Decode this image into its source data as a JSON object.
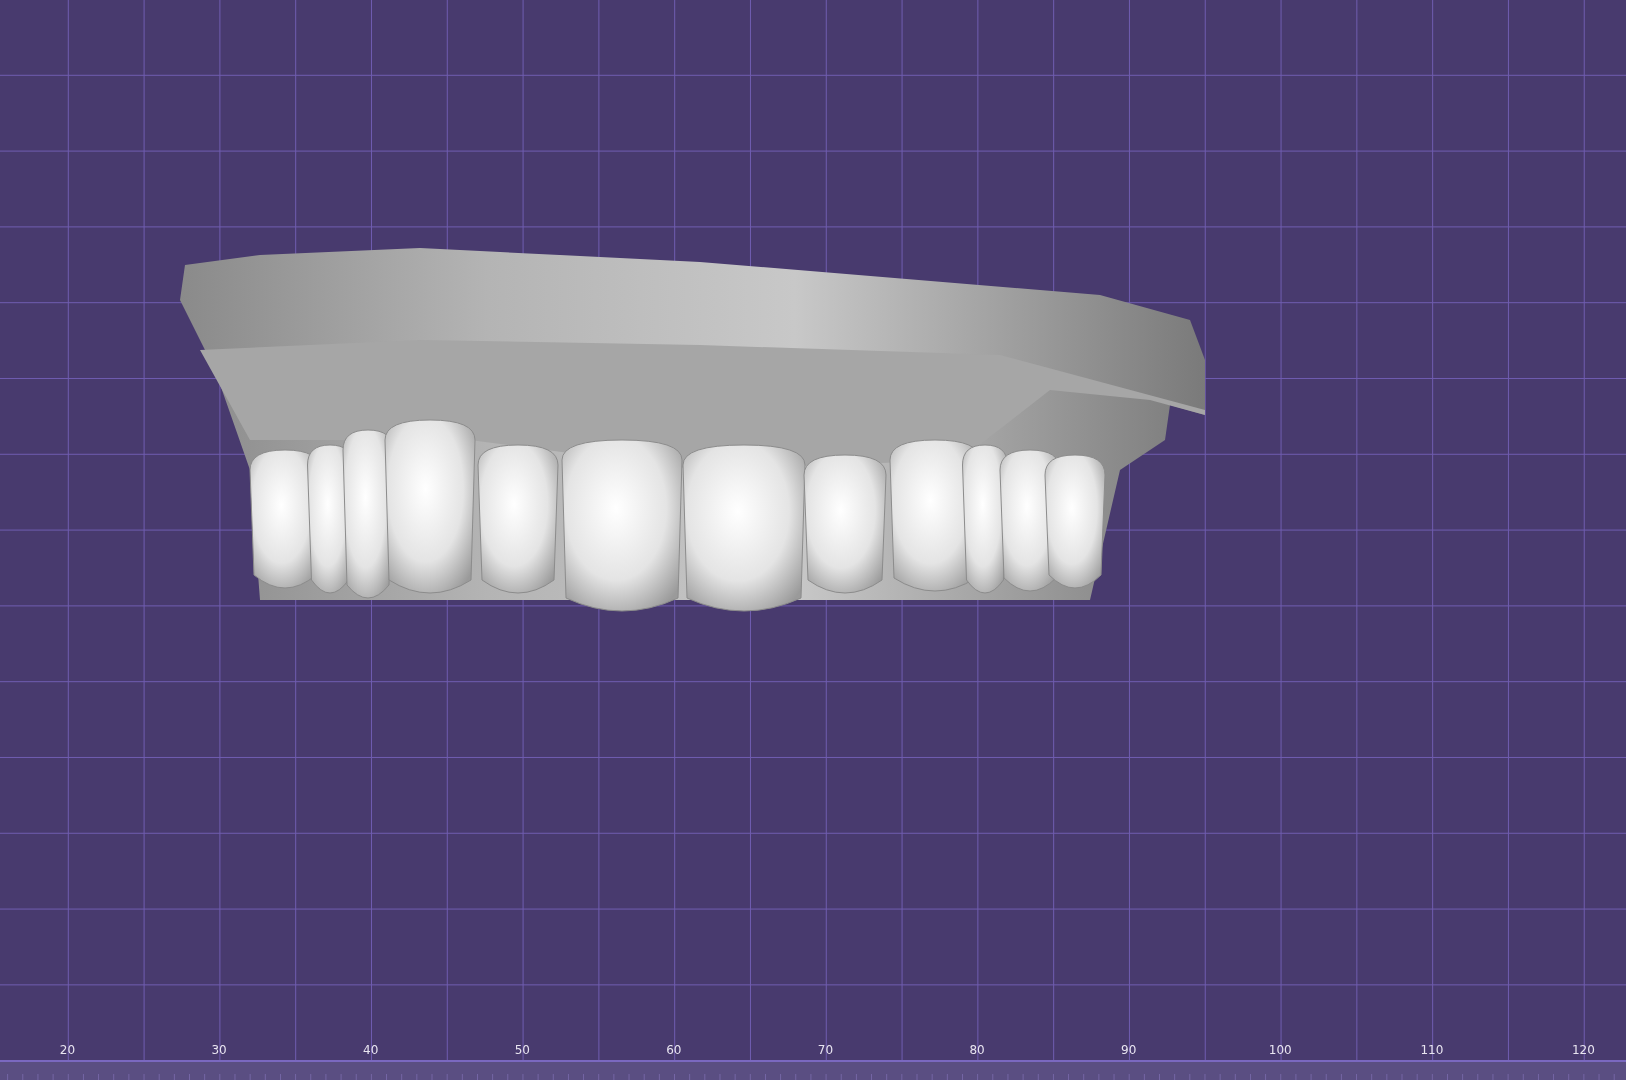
{
  "viewport": {
    "ruler": {
      "labels": [
        "20",
        "30",
        "40",
        "50",
        "60",
        "70",
        "80",
        "90",
        "100",
        "110",
        "120"
      ]
    }
  }
}
